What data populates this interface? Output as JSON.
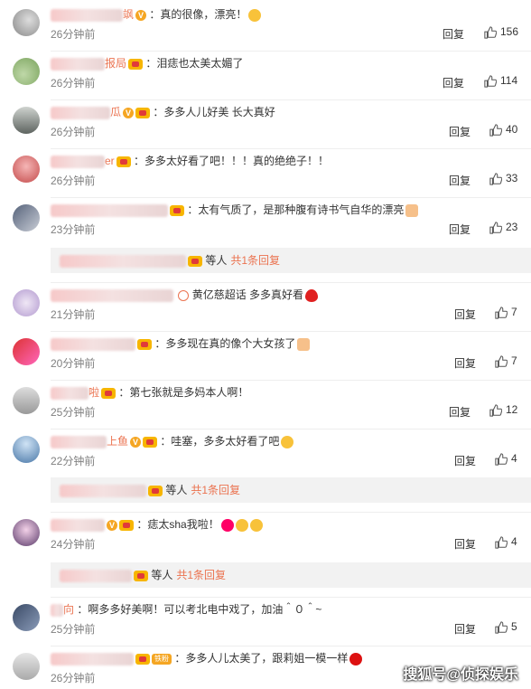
{
  "comments": [
    {
      "name_tail": "飒",
      "badge": "v",
      "badge2": "",
      "text": "：真的很像，漂亮！",
      "time": "26分钟前",
      "reply": "回复",
      "likes": "156",
      "emoji": "surprised"
    },
    {
      "name_tail": "报局",
      "badge": "lv",
      "badge2": "",
      "text": "：泪痣也太美太媚了",
      "time": "26分钟前",
      "reply": "回复",
      "likes": "114",
      "emoji": ""
    },
    {
      "name_tail": "瓜",
      "badge": "v",
      "badge2": "lv",
      "text": "：多多人儿好美 长大真好",
      "time": "26分钟前",
      "reply": "回复",
      "likes": "40",
      "emoji": ""
    },
    {
      "name_tail": "er",
      "badge": "lv",
      "badge2": "",
      "text": "：多多太好看了吧！！！真的绝绝子！！",
      "time": "26分钟前",
      "reply": "回复",
      "likes": "33",
      "emoji": ""
    },
    {
      "name_tail": "",
      "badge": "lv",
      "badge2": "",
      "text": "：太有气质了，是那种腹有诗书气自华的漂亮",
      "time": "23分钟前",
      "reply": "回复",
      "likes": "23",
      "emoji": "hand"
    },
    {
      "name_tail": "",
      "badge": "",
      "badge2": "",
      "text": "黄亿慈超话 多多真好看",
      "time": "21分钟前",
      "reply": "回复",
      "likes": "7",
      "emoji": "heart"
    },
    {
      "name_tail": "",
      "badge": "lv",
      "badge2": "",
      "text": "：多多现在真的像个大女孩了",
      "time": "20分钟前",
      "reply": "回复",
      "likes": "7",
      "emoji": "hand"
    },
    {
      "name_tail": "啦",
      "badge": "lv",
      "badge2": "",
      "text": "：第七张就是多妈本人啊！",
      "time": "25分钟前",
      "reply": "回复",
      "likes": "12",
      "emoji": ""
    },
    {
      "name_tail": "上鱼",
      "badge": "v",
      "badge2": "lv",
      "text": "：哇塞，多多太好看了吧",
      "time": "22分钟前",
      "reply": "回复",
      "likes": "4",
      "emoji": "sad"
    },
    {
      "name_tail": "",
      "badge": "v",
      "badge2": "lv",
      "text": "：痣太sha我啦！",
      "time": "24分钟前",
      "reply": "回复",
      "likes": "4",
      "emoji": "cry"
    },
    {
      "name_tail": "向",
      "badge": "",
      "badge2": "",
      "text": "：啊多多好美啊！可以考北电中戏了，加油＾０＾~",
      "time": "25分钟前",
      "reply": "回复",
      "likes": "5",
      "emoji": ""
    },
    {
      "name_tail": "",
      "badge": "fan",
      "badge2": "",
      "text": "：多多人儿太美了，跟莉姐一模一样",
      "time": "26分钟前",
      "reply": "回复",
      "likes": "",
      "emoji": "rose"
    }
  ],
  "subreplies": [
    {
      "label": "等人",
      "more": "共1条回复"
    },
    {
      "label": "等人",
      "more": "共1条回复"
    },
    {
      "label": "等人",
      "more": "共1条回复"
    }
  ],
  "fan_badge": "铁粉",
  "watermark": "搜狐号@侦探娱乐",
  "colors": {
    "accent": "#eb7350",
    "muted": "#808080",
    "bg_sub": "#f2f2f2"
  }
}
